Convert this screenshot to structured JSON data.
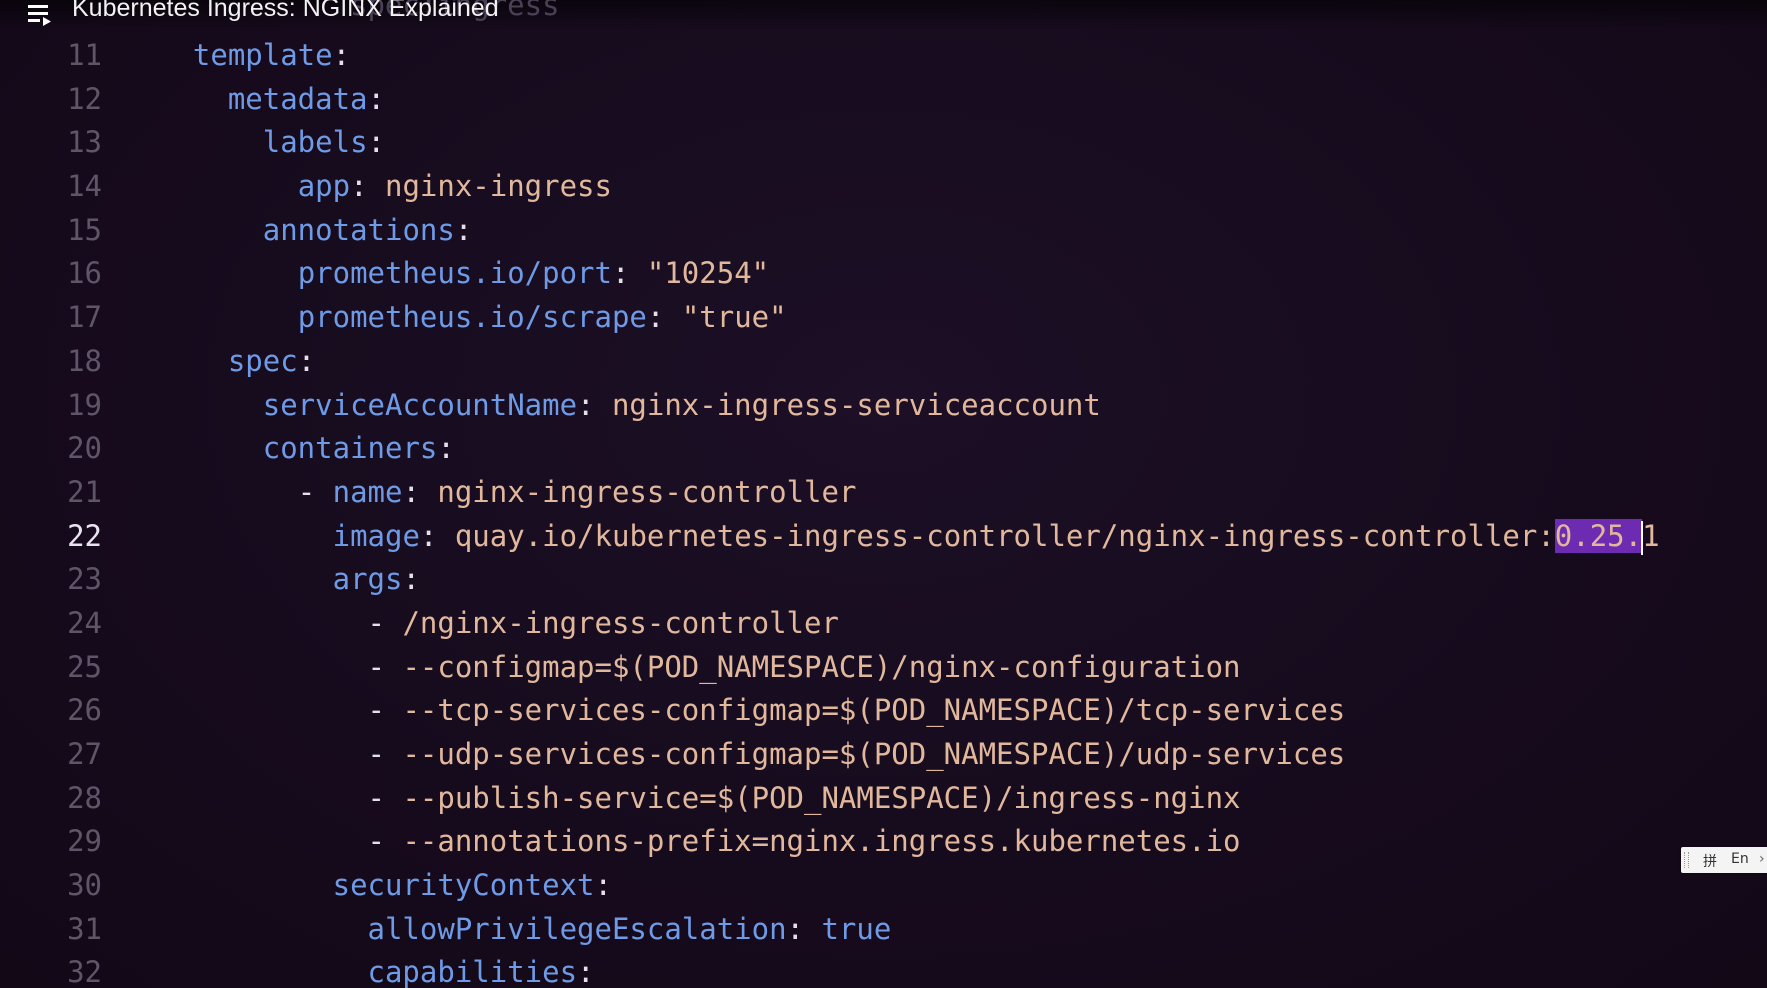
{
  "video": {
    "title": "Kubernetes Ingress: NGINX Explained",
    "playlist_icon": "playlist-icon",
    "ghost_text": "spec:ingress"
  },
  "editor": {
    "active_line": 22,
    "lines": [
      {
        "num": "11",
        "indent": "  ",
        "parts": [
          {
            "t": "key",
            "v": "template"
          },
          {
            "t": "punc",
            "v": ":"
          }
        ]
      },
      {
        "num": "12",
        "indent": "    ",
        "parts": [
          {
            "t": "key",
            "v": "metadata"
          },
          {
            "t": "punc",
            "v": ":"
          }
        ]
      },
      {
        "num": "13",
        "indent": "      ",
        "parts": [
          {
            "t": "key",
            "v": "labels"
          },
          {
            "t": "punc",
            "v": ":"
          }
        ]
      },
      {
        "num": "14",
        "indent": "        ",
        "parts": [
          {
            "t": "key",
            "v": "app"
          },
          {
            "t": "punc",
            "v": ": "
          },
          {
            "t": "val",
            "v": "nginx-ingress"
          }
        ]
      },
      {
        "num": "15",
        "indent": "      ",
        "parts": [
          {
            "t": "key",
            "v": "annotations"
          },
          {
            "t": "punc",
            "v": ":"
          }
        ]
      },
      {
        "num": "16",
        "indent": "        ",
        "parts": [
          {
            "t": "key",
            "v": "prometheus.io/port"
          },
          {
            "t": "punc",
            "v": ": "
          },
          {
            "t": "val",
            "v": "\"10254\""
          }
        ]
      },
      {
        "num": "17",
        "indent": "        ",
        "parts": [
          {
            "t": "key",
            "v": "prometheus.io/scrape"
          },
          {
            "t": "punc",
            "v": ": "
          },
          {
            "t": "val",
            "v": "\"true\""
          }
        ]
      },
      {
        "num": "18",
        "indent": "    ",
        "parts": [
          {
            "t": "key",
            "v": "spec"
          },
          {
            "t": "punc",
            "v": ":"
          }
        ]
      },
      {
        "num": "19",
        "indent": "      ",
        "parts": [
          {
            "t": "key",
            "v": "serviceAccountName"
          },
          {
            "t": "punc",
            "v": ": "
          },
          {
            "t": "val",
            "v": "nginx-ingress-serviceaccount"
          }
        ]
      },
      {
        "num": "20",
        "indent": "      ",
        "parts": [
          {
            "t": "key",
            "v": "containers"
          },
          {
            "t": "punc",
            "v": ":"
          }
        ]
      },
      {
        "num": "21",
        "indent": "        ",
        "parts": [
          {
            "t": "dash",
            "v": "- "
          },
          {
            "t": "key",
            "v": "name"
          },
          {
            "t": "punc",
            "v": ": "
          },
          {
            "t": "val",
            "v": "nginx-ingress-controller"
          }
        ]
      },
      {
        "num": "22",
        "indent": "          ",
        "parts": [
          {
            "t": "key",
            "v": "image"
          },
          {
            "t": "punc",
            "v": ": "
          },
          {
            "t": "val",
            "v": "quay.io/kubernetes-ingress-controller/nginx-ingress-controller:"
          },
          {
            "t": "sel",
            "v": "0.25."
          },
          {
            "t": "caret",
            "v": ""
          },
          {
            "t": "val",
            "v": "1"
          }
        ]
      },
      {
        "num": "23",
        "indent": "          ",
        "parts": [
          {
            "t": "key",
            "v": "args"
          },
          {
            "t": "punc",
            "v": ":"
          }
        ]
      },
      {
        "num": "24",
        "indent": "            ",
        "parts": [
          {
            "t": "dash",
            "v": "- "
          },
          {
            "t": "val",
            "v": "/nginx-ingress-controller"
          }
        ]
      },
      {
        "num": "25",
        "indent": "            ",
        "parts": [
          {
            "t": "dash",
            "v": "- "
          },
          {
            "t": "val",
            "v": "--configmap=$(POD_NAMESPACE)/nginx-configuration"
          }
        ]
      },
      {
        "num": "26",
        "indent": "            ",
        "parts": [
          {
            "t": "dash",
            "v": "- "
          },
          {
            "t": "val",
            "v": "--tcp-services-configmap=$(POD_NAMESPACE)/tcp-services"
          }
        ]
      },
      {
        "num": "27",
        "indent": "            ",
        "parts": [
          {
            "t": "dash",
            "v": "- "
          },
          {
            "t": "val",
            "v": "--udp-services-configmap=$(POD_NAMESPACE)/udp-services"
          }
        ]
      },
      {
        "num": "28",
        "indent": "            ",
        "parts": [
          {
            "t": "dash",
            "v": "- "
          },
          {
            "t": "val",
            "v": "--publish-service=$(POD_NAMESPACE)/ingress-nginx"
          }
        ]
      },
      {
        "num": "29",
        "indent": "            ",
        "parts": [
          {
            "t": "dash",
            "v": "- "
          },
          {
            "t": "val",
            "v": "--annotations-prefix=nginx.ingress.kubernetes.io"
          }
        ]
      },
      {
        "num": "30",
        "indent": "          ",
        "parts": [
          {
            "t": "key",
            "v": "securityContext"
          },
          {
            "t": "punc",
            "v": ":"
          }
        ]
      },
      {
        "num": "31",
        "indent": "            ",
        "parts": [
          {
            "t": "key",
            "v": "allowPrivilegeEscalation"
          },
          {
            "t": "punc",
            "v": ": "
          },
          {
            "t": "bool",
            "v": "true"
          }
        ]
      },
      {
        "num": "32",
        "indent": "            ",
        "parts": [
          {
            "t": "key",
            "v": "capabilities"
          },
          {
            "t": "punc",
            "v": ":"
          }
        ]
      }
    ]
  },
  "ime": {
    "mode_label": "拼",
    "lang_label": "En",
    "arrow_icon": "chevron-right-icon"
  },
  "colors": {
    "background": "#170c1e",
    "key": "#6f9ae6",
    "value": "#e2b89d",
    "selection": "#6c2bb0",
    "line_number": "#5e5569"
  }
}
